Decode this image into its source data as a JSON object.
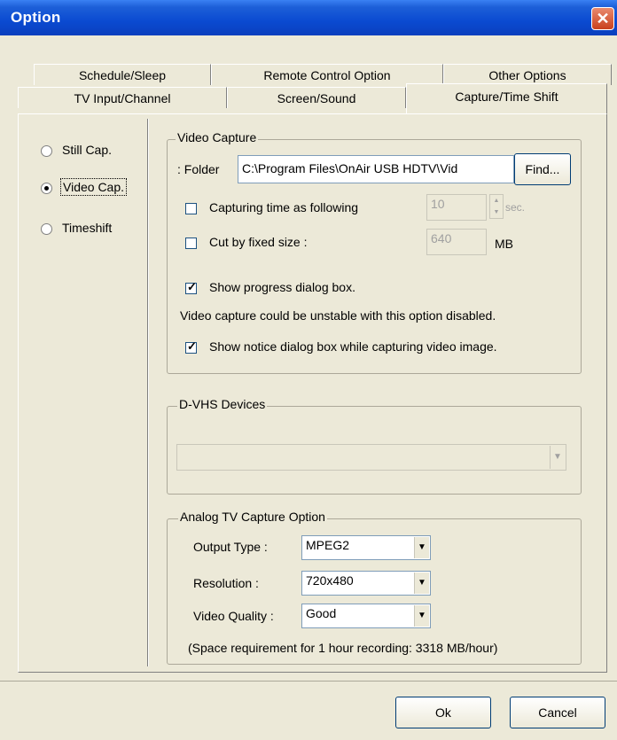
{
  "window": {
    "title": "Option",
    "close": "✕"
  },
  "tabs": {
    "row1": [
      "Schedule/Sleep",
      "Remote Control Option",
      "Other Options"
    ],
    "row2": [
      "TV Input/Channel",
      "Screen/Sound",
      "Capture/Time Shift"
    ]
  },
  "sidebar": {
    "options": [
      "Still Cap.",
      "Video Cap.",
      "Timeshift"
    ],
    "selected": "Video Cap."
  },
  "video_capture": {
    "title": "Video Capture",
    "folder_label": ": Folder",
    "folder_value": "C:\\Program Files\\OnAir USB HDTV\\Vid",
    "find_button": "Find...",
    "capturing_time_label": "Capturing time as following",
    "capturing_time_value": "10",
    "sec_label": "sec.",
    "cut_size_label": "Cut by fixed size :",
    "cut_size_value": "640",
    "mb_label": "MB",
    "show_progress_label": "Show progress dialog box.",
    "warning_text": "Video capture could be unstable with this option disabled.",
    "show_notice_label": "Show notice dialog box while capturing video image."
  },
  "dvhs": {
    "title": "D-VHS Devices",
    "value": ""
  },
  "analog": {
    "title": "Analog TV Capture Option",
    "output_type_label": "Output Type :",
    "output_type_value": "MPEG2",
    "resolution_label": "Resolution :",
    "resolution_value": "720x480",
    "quality_label": "Video Quality :",
    "quality_value": "Good",
    "space_text": "(Space requirement for 1 hour recording: 3318 MB/hour)"
  },
  "footer": {
    "ok": "Ok",
    "cancel": "Cancel"
  }
}
